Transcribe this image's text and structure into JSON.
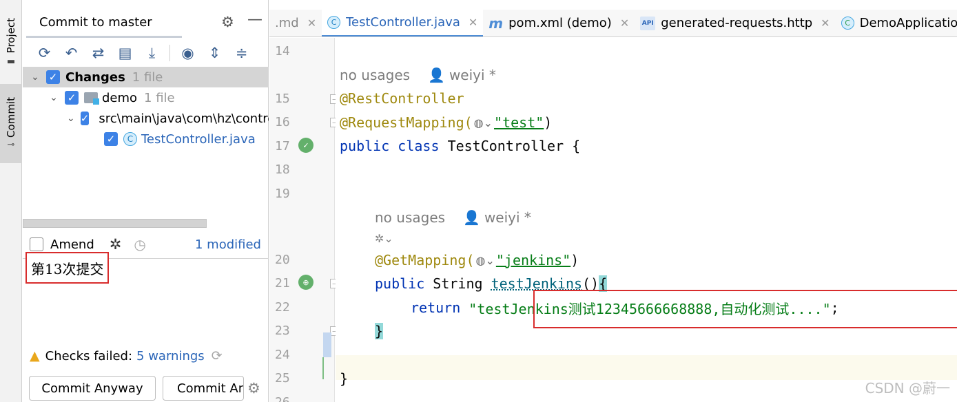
{
  "toolstrip": {
    "project_label": "Project",
    "commit_label": "Commit"
  },
  "panel": {
    "title": "Commit to master",
    "tree": {
      "changes_label": "Changes",
      "changes_count": "1 file",
      "module_label": "demo",
      "module_count": "1 file",
      "path_label": "src\\main\\java\\com\\hz\\controller",
      "file_label": "TestController.java"
    },
    "amend_label": "Amend",
    "modified_link": "1 modified",
    "commit_message": "第13次提交",
    "checks_label": "Checks failed:",
    "checks_link": "5 warnings",
    "commit_anyway": "Commit Anyway",
    "commit_anyway_push": "Commit Anyway and Push..."
  },
  "tabs": [
    {
      "label": ".md",
      "icon": ""
    },
    {
      "label": "TestController.java",
      "icon": "java-class-icon",
      "active": true
    },
    {
      "label": "pom.xml (demo)",
      "icon": "maven-icon"
    },
    {
      "label": "generated-requests.http",
      "icon": "api-icon"
    },
    {
      "label": "DemoApplication",
      "icon": "spring-app-icon"
    }
  ],
  "editor": {
    "lines": [
      "14",
      "15",
      "16",
      "17",
      "18",
      "19",
      "20",
      "21",
      "22",
      "23",
      "24",
      "25",
      "26"
    ],
    "hint_usages": "no usages",
    "hint_author": "weiyi *",
    "code": {
      "ann_restcontroller": "@RestController",
      "ann_requestmapping": "@RequestMapping(",
      "requestmapping_value": "\"test\"",
      "close_paren": ")",
      "kw_public": "public",
      "kw_class": "class",
      "class_name": "TestController {",
      "ann_getmapping": "@GetMapping(",
      "getmapping_value": "\"jenkins\"",
      "type_string": "String",
      "method_name": "testJenkins",
      "method_parens": "()",
      "open_brace": "{",
      "kw_return": "return",
      "return_value": "\"testJenkins测试12345666668888,自动化测试....\"",
      "semicolon": ";",
      "close_brace": "}",
      "class_close": "}"
    }
  },
  "watermark": "CSDN @蔚一"
}
